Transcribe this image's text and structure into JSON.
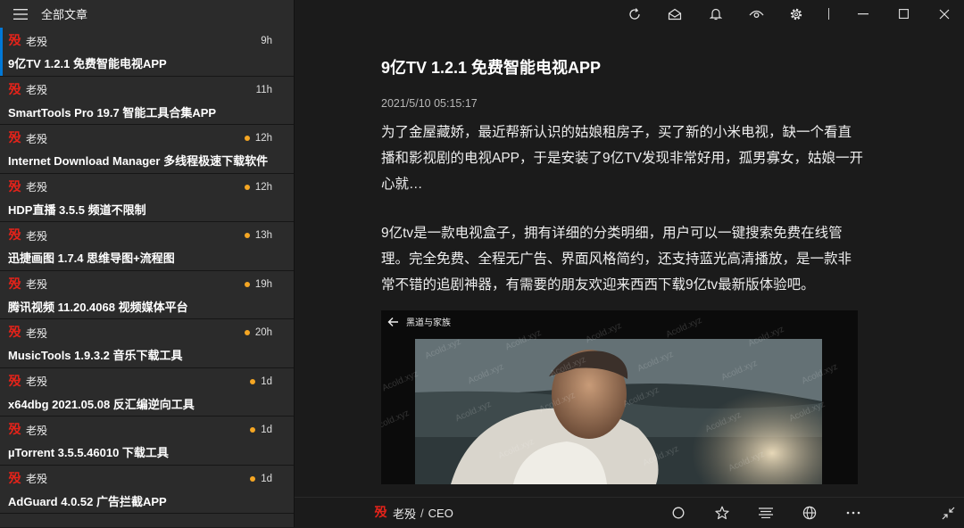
{
  "sidebar": {
    "title": "全部文章",
    "menu_icon": "hamburger-menu-icon",
    "items": [
      {
        "source": "老殁",
        "time": "9h",
        "dot": "",
        "title": "9亿TV 1.2.1 免费智能电视APP"
      },
      {
        "source": "老殁",
        "time": "11h",
        "dot": "",
        "title": "SmartTools Pro 19.7 智能工具合集APP"
      },
      {
        "source": "老殁",
        "time": "12h",
        "dot": "#f5a623",
        "title": "Internet Download Manager 多线程极速下载软件"
      },
      {
        "source": "老殁",
        "time": "12h",
        "dot": "#f5a623",
        "title": "HDP直播 3.5.5 频道不限制"
      },
      {
        "source": "老殁",
        "time": "13h",
        "dot": "#f5a623",
        "title": "迅捷画图 1.7.4 思维导图+流程图"
      },
      {
        "source": "老殁",
        "time": "19h",
        "dot": "#f5a623",
        "title": "腾讯视频 11.20.4068 视频媒体平台"
      },
      {
        "source": "老殁",
        "time": "20h",
        "dot": "#f5a623",
        "title": "MusicTools 1.9.3.2 音乐下载工具"
      },
      {
        "source": "老殁",
        "time": "1d",
        "dot": "#f5a623",
        "title": "x64dbg 2021.05.08 反汇编逆向工具"
      },
      {
        "source": "老殁",
        "time": "1d",
        "dot": "#f5a623",
        "title": "µTorrent 3.5.5.46010 下载工具"
      },
      {
        "source": "老殁",
        "time": "1d",
        "dot": "#f5a623",
        "title": "AdGuard 4.0.52 广告拦截APP"
      }
    ]
  },
  "logo_glyph": "殁",
  "colors": {
    "accent": "#0078d7",
    "logo": "#e2231a",
    "unread_dot": "#f5a623"
  },
  "toolbar": {
    "icons": [
      "refresh-icon",
      "mark-all-read-icon",
      "notification-bell-icon",
      "eye-icon",
      "settings-gear-icon",
      "minimize-icon",
      "maximize-icon",
      "close-icon"
    ]
  },
  "article": {
    "title": "9亿TV 1.2.1 免费智能电视APP",
    "date": "2021/5/10 05:15:17",
    "paragraphs": [
      "为了金屋藏娇，最近帮新认识的姑娘租房子，买了新的小米电视，缺一个看直播和影视剧的电视APP，于是安装了9亿TV发现非常好用，孤男寡女，姑娘一开心就…",
      "9亿tv是一款电视盒子，拥有详细的分类明细，用户可以一键搜索免费在线管理。完全免费、全程无广告、界面风格简约，还支持蓝光高清播放，是一款非常不错的追剧神器，有需要的朋友欢迎来西西下载9亿tv最新版体验吧。"
    ],
    "image": {
      "label": "黑道与家族",
      "watermark": "Acold.xyz"
    }
  },
  "footer": {
    "author": "老殁",
    "role": "CEO",
    "icons": [
      "circle-icon",
      "star-icon",
      "text-format-icon",
      "globe-icon",
      "more-icon",
      "collapse-icon"
    ]
  }
}
